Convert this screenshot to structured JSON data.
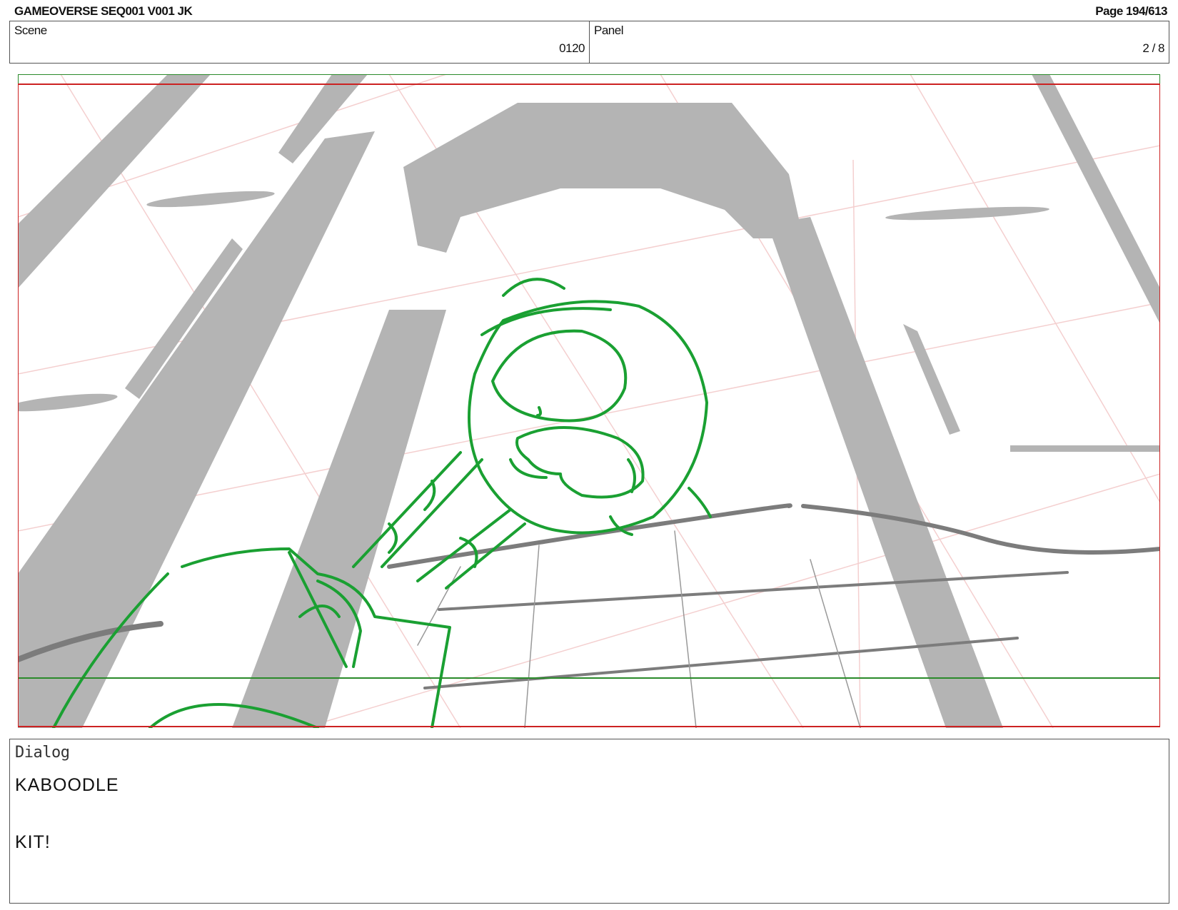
{
  "header": {
    "title": "GAMEOVERSE SEQ001 V001 JK",
    "page": "Page 194/613"
  },
  "info": {
    "scene_label": "Scene",
    "scene_value": "0120",
    "panel_label": "Panel",
    "panel_value": "2 / 8"
  },
  "dialog": {
    "label": "Dialog",
    "lines": [
      "KABOODLE",
      "KIT!"
    ]
  },
  "colors": {
    "safe_frame": "#cc2222",
    "field_guide": "#2a8a2a",
    "sketch_green": "#1aa032",
    "sketch_gray": "#b4b4b4"
  }
}
